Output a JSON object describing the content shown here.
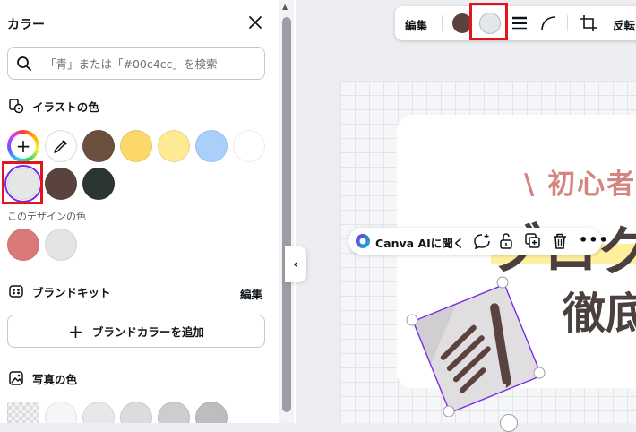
{
  "panel": {
    "title": "カラー",
    "search_placeholder": "「青」または「#00c4cc」を検索",
    "illustration_section": "イラストの色",
    "design_colors_label": "このデザインの色",
    "brand_kit_section": "ブランドキット",
    "brand_kit_edit": "編集",
    "add_brand_color": "ブランドカラーを追加",
    "photo_section": "写真の色"
  },
  "colors": {
    "illustration": [
      "#6b4f3f",
      "#fcd86b",
      "#fdea93",
      "#a9cffb",
      "#ffffff",
      "#e4e6e8",
      "#5a433e",
      "#2b3532"
    ],
    "design": [
      "#d97a79",
      "#e2e4e6"
    ],
    "photo": [
      "#ececec",
      "#f6f6f6",
      "#e8e8e8",
      "#dcdcdc",
      "#cdcdcd",
      "#bdbdbd"
    ],
    "highlight": "#e5131b",
    "accent": "#7d2ae8"
  },
  "toolbar": {
    "edit_label": "編集",
    "flip_label": "反転",
    "swatch_dark": "#5a433e",
    "swatch_light": "#e4e6e8"
  },
  "canvas": {
    "headline_small": "\\ 初心者で",
    "headline_large": "ブログ",
    "headline_2": "徹底"
  },
  "ai_bar": {
    "label": "Canva AIに聞く"
  }
}
